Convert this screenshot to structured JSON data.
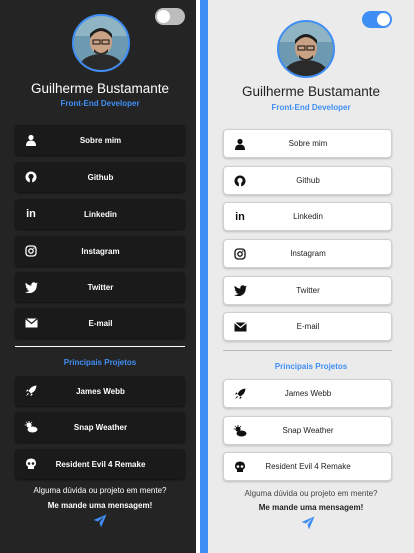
{
  "profile": {
    "name": "Guilherme Bustamante",
    "role": "Front-End Developer"
  },
  "links": [
    {
      "label": "Sobre mim",
      "icon": "user-icon"
    },
    {
      "label": "Github",
      "icon": "github-icon"
    },
    {
      "label": "Linkedin",
      "icon": "linkedin-icon"
    },
    {
      "label": "Instagram",
      "icon": "instagram-icon"
    },
    {
      "label": "Twitter",
      "icon": "twitter-icon"
    },
    {
      "label": "E-mail",
      "icon": "mail-icon"
    }
  ],
  "projects_title": "Principais Projetos",
  "projects": [
    {
      "label": "James Webb",
      "icon": "rocket-icon"
    },
    {
      "label": "Snap Weather",
      "icon": "weather-icon"
    },
    {
      "label": "Resident Evil 4 Remake",
      "icon": "skull-icon"
    }
  ],
  "footer": {
    "question": "Alguma dúvida ou projeto em mente?",
    "cta": "Me mande uma mensagem!"
  },
  "colors": {
    "accent": "#3f8ef5",
    "dark_bg": "#242424",
    "light_bg": "#ebebeb"
  },
  "theme_toggles": {
    "dark_panel": "off",
    "light_panel": "on"
  }
}
